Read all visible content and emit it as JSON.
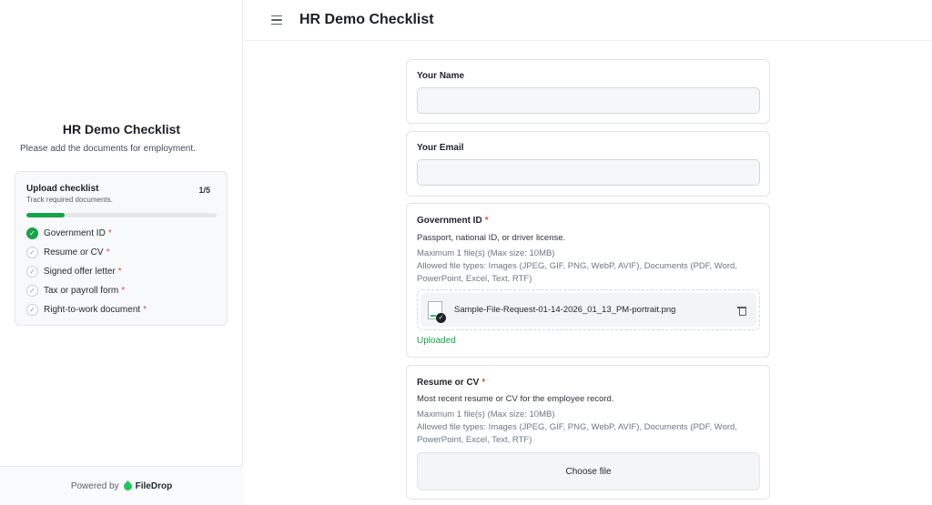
{
  "header": {
    "title": "HR Demo Checklist"
  },
  "sidebar": {
    "title": "HR Demo Checklist",
    "subtitle": "Please add the documents for employment.",
    "checklist": {
      "title": "Upload checklist",
      "subtitle": "Track required documents.",
      "count": "1/5",
      "progress": 0.2,
      "items": [
        {
          "label": "Government ID",
          "done": true,
          "required": true
        },
        {
          "label": "Resume or CV",
          "done": false,
          "required": true
        },
        {
          "label": "Signed offer letter",
          "done": false,
          "required": true
        },
        {
          "label": "Tax or payroll form",
          "done": false,
          "required": true
        },
        {
          "label": "Right-to-work document",
          "done": false,
          "required": true
        }
      ]
    },
    "powered_by": "Powered by",
    "brand": "FileDrop"
  },
  "form": {
    "name": {
      "label": "Your Name",
      "value": ""
    },
    "email": {
      "label": "Your Email",
      "value": ""
    },
    "gov_id": {
      "label": "Government ID",
      "required_mark": "*",
      "description": "Passport, national ID, or driver license.",
      "max_files": "Maximum 1 file(s) (Max size: 10MB)",
      "allowed_types": "Allowed file types: Images (JPEG, GIF, PNG, WebP, AVIF), Documents (PDF, Word, PowerPoint, Excel, Text, RTF)",
      "file_name": "Sample-File-Request-01-14-2026_01_13_PM-portrait.png",
      "status": "Uploaded"
    },
    "resume": {
      "label": "Resume or CV",
      "required_mark": "*",
      "description": "Most recent resume or CV for the employee record.",
      "max_files": "Maximum 1 file(s) (Max size: 10MB)",
      "allowed_types": "Allowed file types: Images (JPEG, GIF, PNG, WebP, AVIF), Documents (PDF, Word, PowerPoint, Excel, Text, RTF)",
      "button_label": "Choose file"
    }
  },
  "icons": {
    "menu": "hamburger-menu-icon",
    "check": "check-icon",
    "trash": "trash-icon",
    "brand": "filedrop-logo-icon"
  },
  "colors": {
    "accent_green": "#16a34a",
    "required_red": "#e5484d"
  }
}
